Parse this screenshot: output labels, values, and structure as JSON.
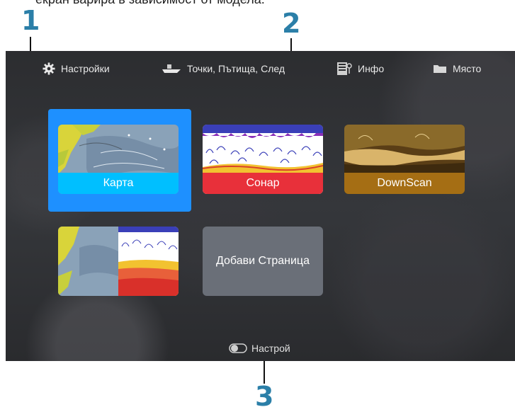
{
  "caption": "екран варира в зависимост от модела.",
  "callouts": {
    "one": "1",
    "two": "2",
    "three": "3"
  },
  "topbar": {
    "settings": "Настройки",
    "waypoints": "Точки, Пътища, След",
    "info": "Инфо",
    "location": "Място"
  },
  "tiles": {
    "chart": "Карта",
    "sonar": "Сонар",
    "downscan": "DownScan",
    "add_page": "Добави Страница"
  },
  "bottom": {
    "customize": "Настрой"
  },
  "colors": {
    "selected": "#1e90ff",
    "chart_label": "#00bfff",
    "sonar_label": "#e8303a",
    "downscan_label": "#a56e14",
    "callout": "#2b7fa8"
  }
}
